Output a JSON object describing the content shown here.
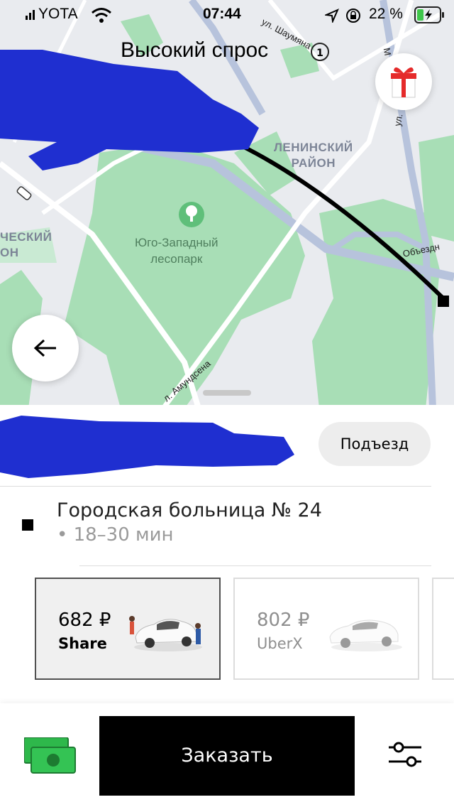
{
  "status_bar": {
    "carrier": "YOTA",
    "time": "07:44",
    "battery_percent": "22 %"
  },
  "map": {
    "demand_banner": "Высокий спрос",
    "demand_icon_text": "1",
    "district_label": "ЛЕНИНСКИЙ\nРАЙОН",
    "district_label_partial": "ЧЕСКИЙ\nОН",
    "park_label": "Юго-Западный\nлесопарк",
    "streets": {
      "shaumyana": "ул. Шаумяна",
      "amundsena": "л. Амундсена",
      "obezdnaya": "Объездн",
      "ul_top": "ул.",
      "ul_right": "ул.",
      "m_letter": "М"
    }
  },
  "sheet": {
    "pickup_button": "Подъезд",
    "destination_name": "Городская больница № 24",
    "destination_eta": "• 18–30 мин",
    "rides": [
      {
        "price": "682 ₽",
        "name": "Share",
        "selected": true
      },
      {
        "price": "802 ₽",
        "name": "UberX",
        "selected": false
      }
    ]
  },
  "bottom": {
    "order_button": "Заказать"
  },
  "colors": {
    "map_bg": "#e9ebef",
    "park_green": "#a8deb6",
    "road": "#ffffff",
    "arterial": "#b7c3dc",
    "redaction_blue": "#1f2fd0"
  },
  "icons": [
    "signal-icon",
    "wifi-icon",
    "location-arrow-icon",
    "rotation-lock-icon",
    "battery-icon",
    "gift-icon",
    "back-arrow-icon",
    "park-tree-icon",
    "cash-payment-icon",
    "filter-settings-icon"
  ]
}
